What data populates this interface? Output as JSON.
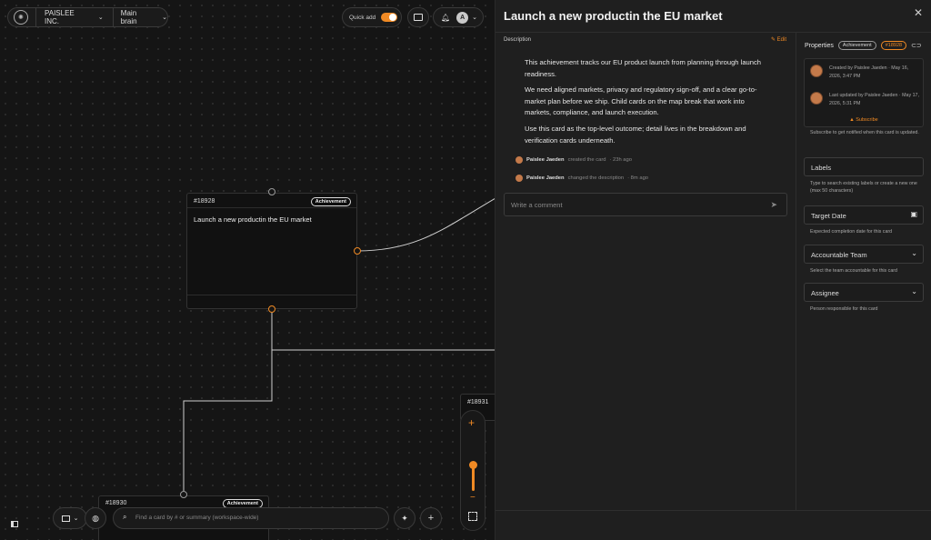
{
  "topbar": {
    "workspace": "PAISLEE INC.",
    "brain": "Main brain",
    "quick_add_label": "Quick add",
    "avatar_letter": "A"
  },
  "canvas": {
    "nodes": [
      {
        "id": "#18928",
        "badge": "Achievement",
        "title": "Launch a new productin the EU market"
      },
      {
        "id": "#18930",
        "badge": "Achievement"
      },
      {
        "id": "#18931"
      }
    ],
    "search_placeholder": "Find a card by # or summary (workspace-wide)"
  },
  "panel": {
    "title": "Launch a new productin the EU market",
    "description_label": "Description",
    "edit_label": "Edit",
    "description": [
      "This achievement tracks our EU product launch from planning through launch readiness.",
      "We need aligned markets, privacy and regulatory sign-off, and a clear go-to-market plan before we ship. Child cards on the map break that work into markets, compliance, and launch execution.",
      "Use this card as the top-level outcome; detail lives in the breakdown and verification cards underneath."
    ],
    "activity": [
      {
        "user": "Paislee Jaeden",
        "action": "created the card",
        "time": "· 23h ago"
      },
      {
        "user": "Paislee Jaeden",
        "action": "changed the description",
        "time": "· 8m ago"
      }
    ],
    "comment_placeholder": "Write a comment"
  },
  "properties": {
    "label": "Properties",
    "type_badge": "Achievement",
    "id_badge": "#18928",
    "created": "Created by Paislee Jaeden · May 16, 2026, 3:47 PM",
    "updated": "Last updated by Paislee Jaeden · May 17, 2026, 5:31 PM",
    "subscribe": "Subscribe",
    "subscribe_hint": "Subscribe to get notified when this card is updated.",
    "labels_placeholder": "Labels",
    "labels_hint": "Type to search existing labels or create a new one (max 50 characters)",
    "target_date_placeholder": "Target Date",
    "target_date_hint": "Expected completion date for this card",
    "team_placeholder": "Accountable Team",
    "team_hint": "Select the team accountable for this card",
    "assignee_placeholder": "Assignee",
    "assignee_hint": "Person responsible for this card"
  },
  "colors": {
    "accent": "#f08a24",
    "panel": "#1f1f1f",
    "canvas": "#151515"
  }
}
